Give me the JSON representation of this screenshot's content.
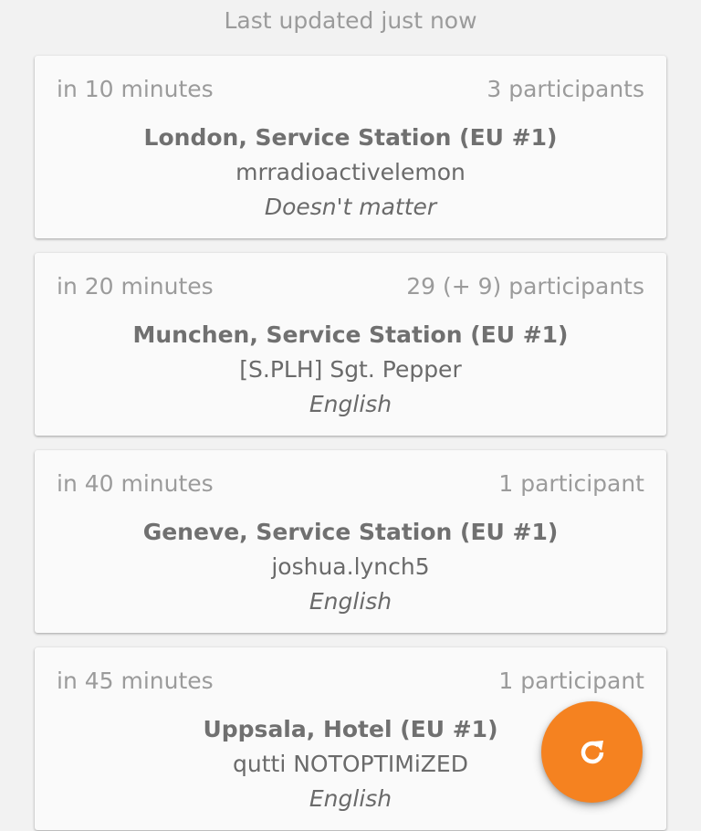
{
  "header": {
    "last_updated": "Last updated just now"
  },
  "convoys": [
    {
      "when": "in 10 minutes",
      "participants": "3 participants",
      "location": "London, Service Station (EU #1)",
      "host": "mrradioactivelemon",
      "language": "Doesn't matter"
    },
    {
      "when": "in 20 minutes",
      "participants": "29 (+ 9) participants",
      "location": "Munchen, Service Station (EU #1)",
      "host": "[S.PLH] Sgt. Pepper",
      "language": "English"
    },
    {
      "when": "in 40 minutes",
      "participants": "1 participant",
      "location": "Geneve, Service Station (EU #1)",
      "host": "joshua.lynch5",
      "language": "English"
    },
    {
      "when": "in 45 minutes",
      "participants": "1 participant",
      "location": "Uppsala, Hotel (EU #1)",
      "host": "qutti NOTOPTIMiZED",
      "language": "English"
    }
  ],
  "fab": {
    "icon": "refresh-icon",
    "color": "#f58220"
  }
}
